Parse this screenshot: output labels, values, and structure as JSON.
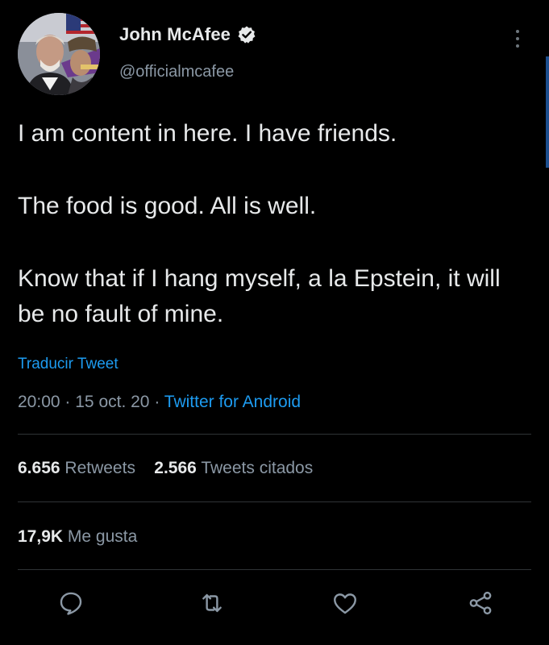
{
  "author": {
    "display_name": "John McAfee",
    "handle": "@officialmcafee",
    "verified": true
  },
  "tweet": {
    "paragraphs": [
      "I am content in here. I have friends.",
      "The food is good. All is well.",
      "Know that if I hang myself, a la Epstein, it will be no fault of mine."
    ],
    "translate_label": "Traducir Tweet",
    "time": "20:00",
    "date": "15 oct. 20",
    "separator": "·",
    "source": "Twitter for Android"
  },
  "stats": {
    "retweets_count": "6.656",
    "retweets_label": "Retweets",
    "quotes_count": "2.566",
    "quotes_label": "Tweets citados",
    "likes_count": "17,9K",
    "likes_label": "Me gusta"
  },
  "actions": [
    {
      "icon": "reply-icon"
    },
    {
      "icon": "retweet-icon"
    },
    {
      "icon": "like-icon"
    },
    {
      "icon": "share-icon"
    }
  ],
  "colors": {
    "background": "#000000",
    "text_primary": "#e7e9ea",
    "text_secondary": "#8b98a5",
    "accent": "#1d9bf0",
    "divider": "#2f3336"
  }
}
